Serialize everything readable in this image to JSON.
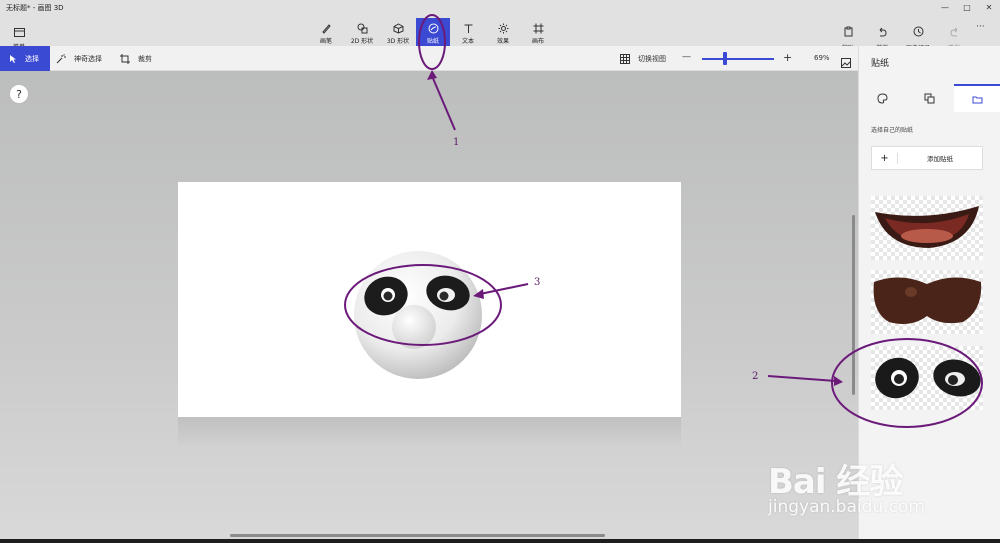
{
  "window": {
    "title": "无标题* - 画图 3D",
    "minimize_glyph": "—",
    "maximize_glyph": "□",
    "close_glyph": "✕"
  },
  "toolbar": {
    "menu_label": "菜单",
    "tools": [
      {
        "label": "画笔",
        "icon": "brush-icon"
      },
      {
        "label": "2D 形状",
        "icon": "2d-shapes-icon"
      },
      {
        "label": "3D 形状",
        "icon": "3d-shapes-icon"
      },
      {
        "label": "贴纸",
        "icon": "sticker-icon",
        "active": true
      },
      {
        "label": "文本",
        "icon": "text-icon"
      },
      {
        "label": "效果",
        "icon": "effects-icon"
      },
      {
        "label": "画布",
        "icon": "canvas-icon"
      }
    ],
    "right_tools": [
      {
        "label": "粘贴",
        "icon": "paste-icon"
      },
      {
        "label": "撤消",
        "icon": "undo-icon"
      },
      {
        "label": "历史记录",
        "icon": "history-icon"
      },
      {
        "label": "重做",
        "icon": "redo-icon",
        "disabled": true
      }
    ],
    "more_glyph": "···"
  },
  "subbar": {
    "select_label": "选择",
    "magic_select_label": "神奇选择",
    "crop_label": "裁剪",
    "switch_view_label": "切换视图",
    "zoom_minus": "—",
    "zoom_plus": "+",
    "zoom_value": "69%"
  },
  "help_glyph": "?",
  "panel": {
    "title": "贴纸",
    "tabs": [
      {
        "icon": "palette-icon"
      },
      {
        "icon": "layers-icon"
      },
      {
        "icon": "folder-icon",
        "active": true
      }
    ],
    "section_label": "选择自己的贴纸",
    "add_plus": "+",
    "add_label": "添加贴纸",
    "stickers": [
      {
        "name": "mouth-sticker"
      },
      {
        "name": "mustache-sticker"
      },
      {
        "name": "panda-eyes-sticker"
      }
    ]
  },
  "annotations": {
    "label_1": "1",
    "label_2": "2",
    "label_3": "3",
    "color": "#6b1a7a"
  },
  "watermark": {
    "logo": "Bai  经验",
    "url": "jingyan.baidu.com"
  },
  "colors": {
    "accent": "#3b4ad3",
    "annotation": "#6b1a7a"
  }
}
